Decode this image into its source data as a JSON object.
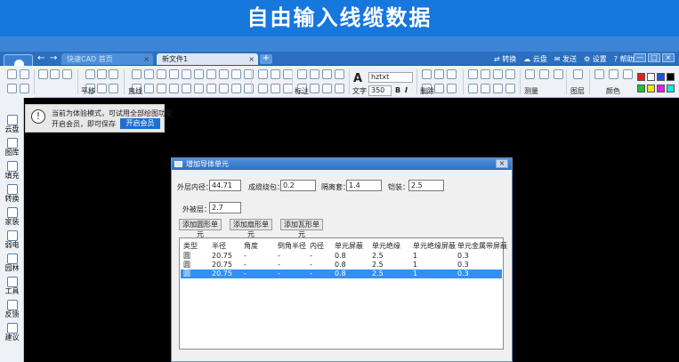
{
  "banner": {
    "title": "自由输入线缆数据"
  },
  "titlebar": {
    "nav_back": "←",
    "nav_forward": "→",
    "tabs": [
      {
        "label": "快速CAD 首页",
        "close": "×"
      },
      {
        "label": "新文件1",
        "close": "×"
      }
    ],
    "add_tab": "+",
    "actions": {
      "convert": "转换",
      "cloud": "云盘",
      "send": "发送",
      "settings": "设置",
      "help": "帮助"
    },
    "window": {
      "minimize": "—",
      "restore": "□",
      "close": "×"
    }
  },
  "toolbar": {
    "pan": "平移",
    "line": "直线",
    "annotate": "标注",
    "text": "文字",
    "font_name": "hztxt",
    "text_height": "350",
    "bold": "B",
    "italic": "I",
    "delete": "删除",
    "measure": "测量",
    "layer": "图层",
    "color": "颜色",
    "colors": [
      "#e02020",
      "#ffffff",
      "#2050e0",
      "#000000",
      "#20c040",
      "#f0e020",
      "#e020e0",
      "#20e0e0"
    ]
  },
  "sidebar": {
    "items": [
      {
        "label": "云盘",
        "icon": "cloud-icon"
      },
      {
        "label": "图库",
        "icon": "gallery-icon"
      },
      {
        "label": "填充",
        "icon": "hatch-icon"
      },
      {
        "label": "转换",
        "icon": "convert-icon"
      },
      {
        "label": "家装",
        "icon": "home-icon"
      },
      {
        "label": "弱电",
        "icon": "lowvoltage-icon"
      },
      {
        "label": "园林",
        "icon": "garden-icon"
      },
      {
        "label": "工具",
        "icon": "tools-icon"
      },
      {
        "label": "反馈",
        "icon": "feedback-icon"
      },
      {
        "label": "建议",
        "icon": "suggestion-icon"
      }
    ]
  },
  "notice": {
    "icon": "!",
    "line1": "当前为体验模式，可试用全部绘图功能",
    "line2": "开启会员，即可保存",
    "button": "开启会员"
  },
  "dialog": {
    "title": "增加导体单元",
    "close": "×",
    "fields": {
      "outer_diameter_label": "外层内径：",
      "outer_diameter": "44.71",
      "binding_label": "成缆绕包：",
      "binding": "0.2",
      "isolation_label": "隔离套：",
      "isolation": "1.4",
      "armor_label": "铠装：",
      "armor": "2.5",
      "sheath_label": "外被层：",
      "sheath": "2.7"
    },
    "buttons": {
      "add_circle": "添加圆形单元",
      "add_sector": "添加扇形单元",
      "add_tile": "添加瓦形单元"
    },
    "table": {
      "headers": [
        "类型",
        "半径",
        "角度",
        "倒角半径",
        "内径",
        "单元屏蔽",
        "单元绝缘",
        "单元绝缘屏蔽",
        "单元金属带屏蔽"
      ],
      "rows": [
        [
          "圆",
          "20.75",
          "-",
          "-",
          "-",
          "0.8",
          "2.5",
          "1",
          "0.3"
        ],
        [
          "圆",
          "20.75",
          "-",
          "-",
          "-",
          "0.8",
          "2.5",
          "1",
          "0.3"
        ],
        [
          "圆",
          "20.75",
          "-",
          "-",
          "-",
          "0.8",
          "2.5",
          "1",
          "0.3"
        ]
      ],
      "selected_row": 2
    }
  }
}
